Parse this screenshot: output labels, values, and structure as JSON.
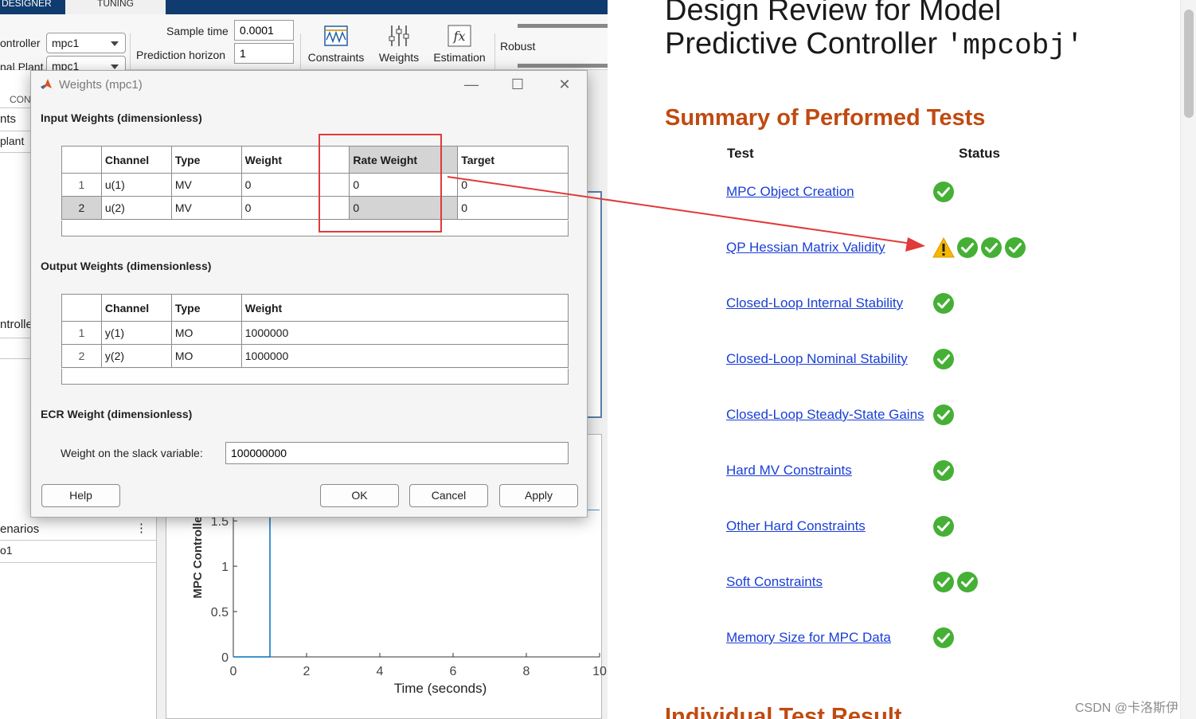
{
  "designer": {
    "tabs": [
      "DESIGNER",
      "TUNING"
    ],
    "toolstrip": {
      "controller_label": "ontroller",
      "controller_value": "mpc1",
      "plant_label": "nal Plant",
      "plant_value": "mpc1",
      "sample_time_label": "Sample time",
      "sample_time_value": "0.0001",
      "prediction_horizon_label": "Prediction horizon",
      "prediction_horizon_value": "1",
      "buttons": {
        "constraints": "Constraints",
        "weights": "Weights",
        "estimation": "Estimation",
        "robust": "Robust"
      }
    },
    "left_panel": {
      "header": "CON",
      "items": [
        "nts",
        "plant"
      ],
      "controller_item": "ntrolle",
      "scenarios_header": "enarios",
      "scenario_item": "o1",
      "menu_icon": "⋮"
    }
  },
  "chart_data": {
    "type": "line",
    "ylabel": "MPC Controlle",
    "xlabel": "Time (seconds)",
    "x_ticks": [
      "0",
      "2",
      "4",
      "6",
      "8",
      "10"
    ],
    "y_ticks": [
      "0",
      "0.5",
      "1",
      "1.5"
    ],
    "xlim": [
      0,
      10
    ],
    "ylim": [
      0,
      1.8
    ],
    "series": [
      {
        "x": [
          0,
          1,
          1,
          10
        ],
        "y": [
          0,
          0,
          1.8,
          1.8
        ],
        "color": "#0072bd"
      }
    ]
  },
  "dialog": {
    "title": "Weights (mpc1)",
    "input_section": "Input Weights (dimensionless)",
    "input_table": {
      "columns": [
        "",
        "Channel",
        "Type",
        "Weight",
        "Rate Weight",
        "Target"
      ],
      "rows": [
        [
          "1",
          "u(1)",
          "MV",
          "0",
          "0",
          "0"
        ],
        [
          "2",
          "u(2)",
          "MV",
          "0",
          "0",
          "0"
        ]
      ]
    },
    "output_section": "Output Weights (dimensionless)",
    "output_table": {
      "columns": [
        "",
        "Channel",
        "Type",
        "Weight"
      ],
      "rows": [
        [
          "1",
          "y(1)",
          "MO",
          "1000000"
        ],
        [
          "2",
          "y(2)",
          "MO",
          "1000000"
        ]
      ]
    },
    "ecr_section": "ECR Weight (dimensionless)",
    "slack_label": "Weight on the slack variable:",
    "slack_value": "100000000",
    "buttons": {
      "help": "Help",
      "ok": "OK",
      "cancel": "Cancel",
      "apply": "Apply"
    }
  },
  "report": {
    "title_line1": "Design Review for Model",
    "title_line2_text": "Predictive Controller ",
    "title_line2_code": "'mpcobj'",
    "summary_heading": "Summary of Performed Tests",
    "col_test": "Test",
    "col_status": "Status",
    "tests": [
      {
        "name": "MPC Object Creation",
        "status": [
          "pass"
        ]
      },
      {
        "name": "QP Hessian Matrix Validity",
        "status": [
          "warning",
          "pass",
          "pass",
          "pass"
        ]
      },
      {
        "name": "Closed-Loop Internal Stability",
        "status": [
          "pass"
        ]
      },
      {
        "name": "Closed-Loop Nominal Stability",
        "status": [
          "pass"
        ]
      },
      {
        "name": "Closed-Loop Steady-State Gains",
        "status": [
          "pass"
        ]
      },
      {
        "name": "Hard MV Constraints",
        "status": [
          "pass"
        ]
      },
      {
        "name": "Other Hard Constraints",
        "status": [
          "pass"
        ]
      },
      {
        "name": "Soft Constraints",
        "status": [
          "pass",
          "pass"
        ]
      },
      {
        "name": "Memory Size for MPC Data",
        "status": [
          "pass"
        ]
      }
    ],
    "next_heading": "Individual Test Result"
  },
  "watermark": "CSDN @卡洛斯伊",
  "colors": {
    "pass": "#45b035",
    "warning": "#f5b800",
    "link": "#1a3fd6",
    "heading": "#c04a10",
    "highlight": "#e03a3a"
  }
}
